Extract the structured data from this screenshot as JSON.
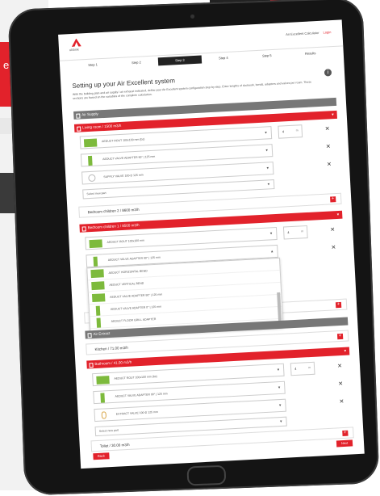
{
  "background": {
    "side_text": "e v\nci"
  },
  "header": {
    "logo": "ubbink",
    "account": "Air Excellent Calculator",
    "login": "Login"
  },
  "steps": [
    {
      "label": "Step 1"
    },
    {
      "label": "Step 2"
    },
    {
      "label": "Step 3",
      "active": true
    },
    {
      "label": "Step 4"
    },
    {
      "label": "Step 5"
    },
    {
      "label": "Results"
    }
  ],
  "page": {
    "title": "Setting up your Air Excellent system",
    "description": "With the building plan and air supply / air exhaust indicated, define your Air Excellent system configuration step by step. Enter lengths of ductwork, bends, adapters and valves per room. These sections are based on the variables of the complete calculation."
  },
  "sections": {
    "air_supply": "Air Supply",
    "living_room": "Living room / 1500 m3/h",
    "bedroom_children_1": "Bedroom children 1 / 8500 m3/h",
    "air_extract": "Air Extract",
    "bathroom": "Bathroom / 41.00 m3/h"
  },
  "living_room_parts": [
    {
      "label": "AEDUCT ROUT 100x100 mm (bs)",
      "qty": "4",
      "unit": "m"
    },
    {
      "label": "AEDUCT VALVE ADAPTER 90° | 125 mm"
    },
    {
      "label": "SUPPLY VALVE 100-D 125 mm"
    }
  ],
  "bedroom_parts": [
    {
      "label": "AEDUCT ROUT 100x100 mm",
      "qty": "4",
      "unit": "m"
    },
    {
      "label": "AEDUCT VALVE ADAPTER 90° | 125 mm"
    }
  ],
  "dropdown_options": [
    {
      "label": "AEDUCT HORIZONTAL BEND"
    },
    {
      "label": "AEDUCT VERTICAL BEND"
    },
    {
      "label": "AEDUCT VALVE ADAPTER 90° | 125 mm"
    },
    {
      "label": "AEDUCT VALVE ADAPTER 0° | 125 mm"
    },
    {
      "label": "AEDUCT FLOOR GRILL ADAPTER"
    }
  ],
  "bathroom_parts": [
    {
      "label": "AEDUCT ROUT 100x100 mm (bs)",
      "qty": "4",
      "unit": "m"
    },
    {
      "label": "AEDUCT VALVE ADAPTER 90° | 125 mm"
    },
    {
      "label": "EXTRACT VALVE 100-D 125 mm"
    }
  ],
  "select_new_part": "Select new part",
  "rooms": {
    "bedroom_children_2": "Bedroom children 2 / 8600 m3/h",
    "kitchen": "Kitchen / 71.00 m3/h",
    "toilet": "Toilet / 30.00 m3/h"
  },
  "buttons": {
    "back": "Back",
    "next": "Next"
  },
  "colors": {
    "brand_red": "#e2222b",
    "section_gray": "#777777",
    "tablet_body": "#141414"
  }
}
